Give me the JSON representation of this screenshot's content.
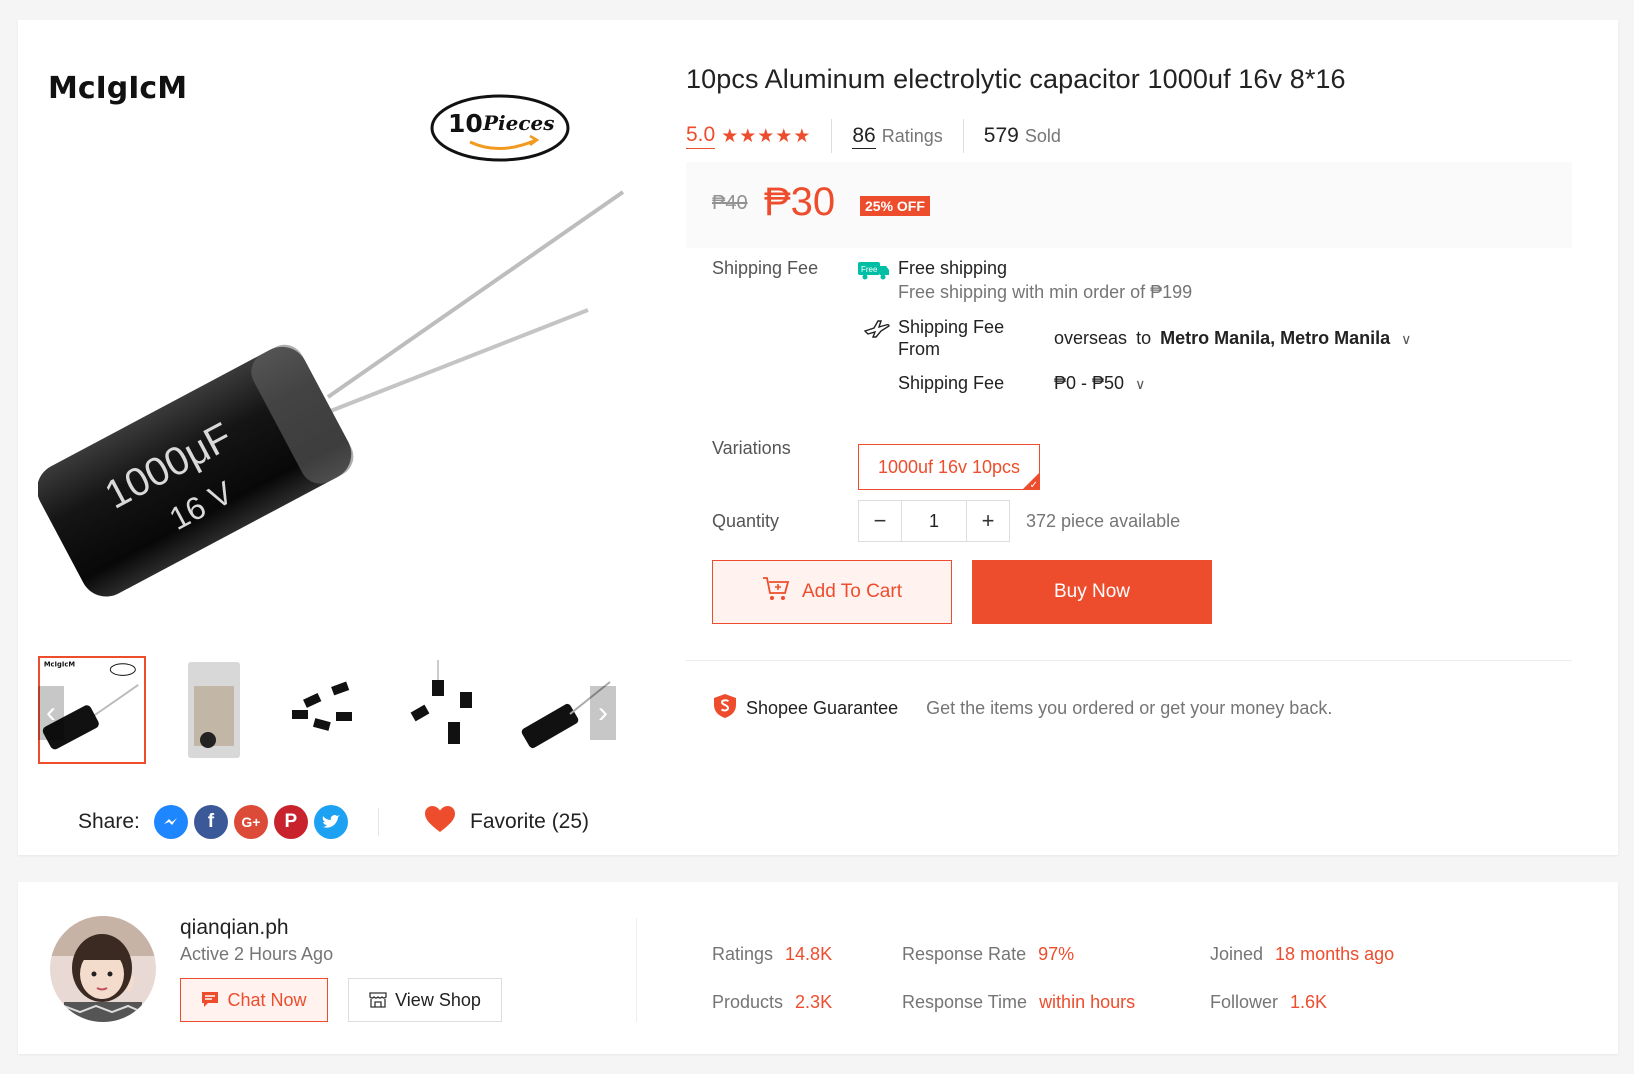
{
  "product": {
    "title": "10pcs Aluminum electrolytic capacitor 1000uf 16v 8*16",
    "brand_logo": "McIgIcM",
    "image_badge": {
      "number": "10",
      "word": "Pieces"
    },
    "capacitor_print": {
      "value": "1000μF",
      "voltage": "16 V"
    },
    "rating": "5.0",
    "stars": "★★★★★",
    "rating_count": "86",
    "rating_label": "Ratings",
    "sold_count": "579",
    "sold_label": "Sold",
    "old_price": "₱40",
    "price": "₱30",
    "discount": "25% OFF"
  },
  "shipping": {
    "label": "Shipping Fee",
    "free_badge": "Free",
    "free_title": "Free shipping",
    "free_sub": "Free shipping with min order of ₱199",
    "from_label": "Shipping Fee From",
    "from_value": "overseas",
    "to_word": "to",
    "destination": "Metro Manila, Metro Manila",
    "fee_label": "Shipping Fee",
    "fee_value": "₱0 - ₱50"
  },
  "variations": {
    "label": "Variations",
    "selected": "1000uf 16v 10pcs"
  },
  "quantity": {
    "label": "Quantity",
    "value": "1",
    "available": "372 piece available",
    "minus": "−",
    "plus": "+"
  },
  "actions": {
    "add_to_cart": "Add To Cart",
    "buy_now": "Buy Now"
  },
  "guarantee": {
    "label": "Shopee Guarantee",
    "text": "Get the items you ordered or get your money back."
  },
  "share": {
    "label": "Share:",
    "favorite": "Favorite (25)"
  },
  "gallery": {
    "prev": "‹",
    "next": "›"
  },
  "shop": {
    "name": "qianqian.ph",
    "active": "Active 2 Hours Ago",
    "chat_now": "Chat Now",
    "view_shop": "View Shop",
    "stats": [
      {
        "label": "Ratings",
        "value": "14.8K"
      },
      {
        "label": "Products",
        "value": "2.3K"
      },
      {
        "label": "Response Rate",
        "value": "97%"
      },
      {
        "label": "Response Time",
        "value": "within hours"
      },
      {
        "label": "Joined",
        "value": "18 months ago"
      },
      {
        "label": "Follower",
        "value": "1.6K"
      }
    ]
  },
  "colors": {
    "accent": "#ee4d2d",
    "text": "#222222",
    "muted": "#757575"
  },
  "icons": [
    "star-icon",
    "free-shipping-truck-icon",
    "airplane-icon",
    "chevron-down-icon",
    "cart-icon",
    "shopee-shield-icon",
    "messenger-icon",
    "facebook-icon",
    "google-plus-icon",
    "pinterest-icon",
    "twitter-icon",
    "heart-icon",
    "chat-icon",
    "shop-icon"
  ]
}
